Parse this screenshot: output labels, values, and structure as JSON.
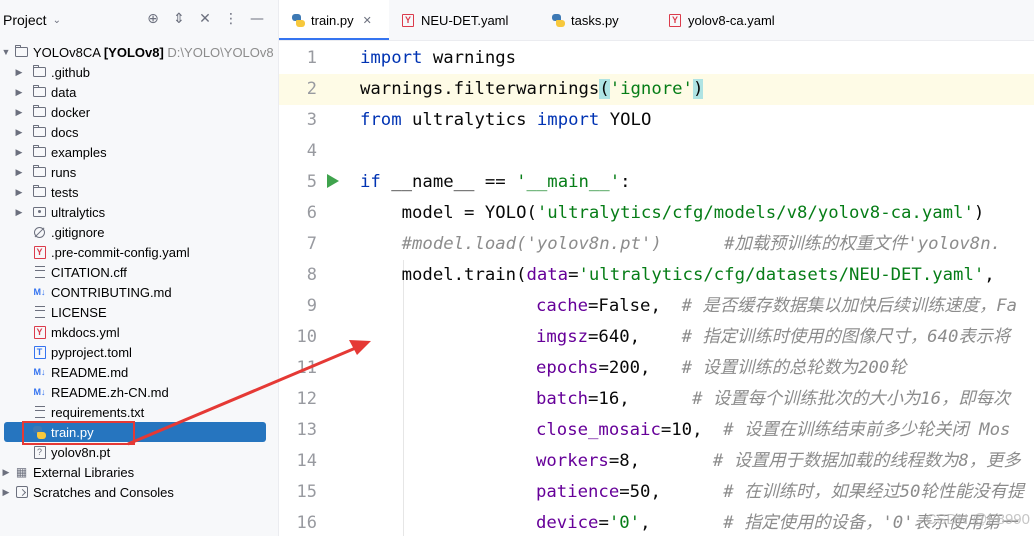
{
  "project_panel": {
    "title": "Project",
    "root": {
      "name": "YOLOv8CA",
      "module": "[YOLOv8]",
      "path": "D:\\YOLO\\YOLOv8"
    },
    "items": [
      {
        "label": ".github",
        "icon": "folder-icon"
      },
      {
        "label": "data",
        "icon": "folder-icon"
      },
      {
        "label": "docker",
        "icon": "folder-icon"
      },
      {
        "label": "docs",
        "icon": "folder-icon"
      },
      {
        "label": "examples",
        "icon": "folder-icon"
      },
      {
        "label": "runs",
        "icon": "folder-icon"
      },
      {
        "label": "tests",
        "icon": "folder-icon"
      },
      {
        "label": "ultralytics",
        "icon": "package-icon"
      },
      {
        "label": ".gitignore",
        "icon": "ignore-file-icon"
      },
      {
        "label": ".pre-commit-config.yaml",
        "icon": "yaml-file-icon"
      },
      {
        "label": "CITATION.cff",
        "icon": "text-file-icon"
      },
      {
        "label": "CONTRIBUTING.md",
        "icon": "markdown-file-icon"
      },
      {
        "label": "LICENSE",
        "icon": "text-file-icon"
      },
      {
        "label": "mkdocs.yml",
        "icon": "yaml-file-icon"
      },
      {
        "label": "pyproject.toml",
        "icon": "toml-file-icon"
      },
      {
        "label": "README.md",
        "icon": "markdown-file-icon"
      },
      {
        "label": "README.zh-CN.md",
        "icon": "markdown-file-icon"
      },
      {
        "label": "requirements.txt",
        "icon": "text-file-icon"
      },
      {
        "label": "train.py",
        "icon": "python-file-icon",
        "selected": true
      },
      {
        "label": "yolov8n.pt",
        "icon": "unknown-file-icon"
      }
    ],
    "external_libraries": "External Libraries",
    "scratches": "Scratches and Consoles"
  },
  "tabs": [
    {
      "label": "train.py",
      "icon": "python-file-icon",
      "active": true
    },
    {
      "label": "NEU-DET.yaml",
      "icon": "yaml-file-icon"
    },
    {
      "label": "tasks.py",
      "icon": "python-file-icon"
    },
    {
      "label": "yolov8-ca.yaml",
      "icon": "yaml-file-icon"
    }
  ],
  "editor": {
    "line_numbers": [
      "1",
      "2",
      "3",
      "4",
      "5",
      "6",
      "7",
      "8",
      "9",
      "10",
      "11",
      "12",
      "13",
      "14",
      "15",
      "16"
    ],
    "code": {
      "l1_kw": "import",
      "l1_rest": " warnings",
      "l2_a": "warnings.filterwarnings",
      "l2_b": "(",
      "l2_str": "'ignore'",
      "l2_c": ")",
      "l3_kw1": "from",
      "l3_mod": " ultralytics ",
      "l3_kw2": "import",
      "l3_rest": " YOLO",
      "l5_kw": "if",
      "l5_a": " __name__ == ",
      "l5_str": "'__main__'",
      "l5_b": ":",
      "l6_a": "    model = YOLO(",
      "l6_str": "'ultralytics/cfg/models/v8/yolov8-ca.yaml'",
      "l6_b": ")",
      "l7_cmt": "    #model.load('yolov8n.pt')      #加载预训练的权重文件'yolov8n.",
      "l8_a": "    model.train(",
      "l8_p": "data",
      "l8_eq": "=",
      "l8_str": "'ultralytics/cfg/datasets/NEU-DET.yaml'",
      "l8_b": ",",
      "l9_p": "cache",
      "l9_v": "=False,  ",
      "l9_c": "# 是否缓存数据集以加快后续训练速度，Fa",
      "l10_p": "imgsz",
      "l10_v": "=640,    ",
      "l10_c": "# 指定训练时使用的图像尺寸，640表示将",
      "l11_p": "epochs",
      "l11_v": "=200,   ",
      "l11_c": "# 设置训练的总轮数为200轮",
      "l12_p": "batch",
      "l12_v": "=16,      ",
      "l12_c": "# 设置每个训练批次的大小为16，即每次",
      "l13_p": "close_mosaic",
      "l13_v": "=10,  ",
      "l13_c": "# 设置在训练结束前多少轮关闭 Mos",
      "l14_p": "workers",
      "l14_v": "=8,       ",
      "l14_c": "# 设置用于数据加载的线程数为8，更多",
      "l15_p": "patience",
      "l15_v": "=50,      ",
      "l15_c": "# 在训练时，如果经过50轮性能没有提",
      "l16_p": "device",
      "l16_v": "=",
      "l16_str": "'0'",
      "l16_v2": ",       ",
      "l16_c": "# 指定使用的设备，'0'表示使用第一"
    }
  },
  "watermark": "CSDN @F8990",
  "annotation_color": "#e53935"
}
